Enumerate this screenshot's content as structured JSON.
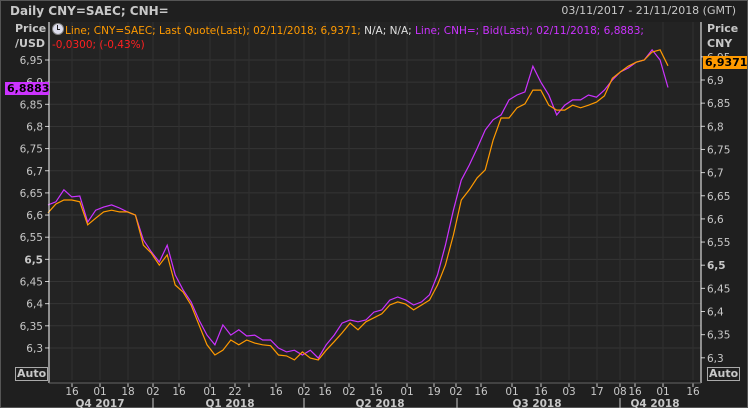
{
  "header": {
    "title": "Daily CNY=SAEC; CNH=",
    "date_range": "03/11/2017 - 21/11/2018 (GMT)"
  },
  "left_axis": {
    "title_line1": "Price",
    "title_line2": "/USD",
    "auto_label": "Auto"
  },
  "right_axis": {
    "title_line1": "Price",
    "title_line2": "CNY",
    "auto_label": "Auto"
  },
  "legend": {
    "icon": "clock-icon",
    "cny_text": "Line; CNY=SAEC; Last Quote(Last); 02/11/2018; 6,9371;",
    "na_text": "N/A; N/A;",
    "cnh_text": "Line; CNH=; Bid(Last); 02/11/2018; 6,8883;",
    "change_text": "-0,0300; (-0,43%)"
  },
  "badges": {
    "cnh_last": "6,8883",
    "cny_last": "6,9371"
  },
  "colors": {
    "cny": "#ff9a00",
    "cnh": "#cc33ff",
    "change": "#ff2020",
    "grid": "#333333"
  },
  "chart_data": {
    "type": "line",
    "title": "Daily CNY=SAEC; CNH=",
    "xlabel": "",
    "ylabel_left": "Price /USD",
    "ylabel_right": "Price CNY",
    "ylim_left": [
      6.25,
      7.0
    ],
    "ylim_right": [
      6.25,
      7.0
    ],
    "y_ticks_left": [
      {
        "v": 6.95,
        "label": "6,95"
      },
      {
        "v": 6.9,
        "label": "6,9"
      },
      {
        "v": 6.85,
        "label": "6,85"
      },
      {
        "v": 6.8,
        "label": "6,8"
      },
      {
        "v": 6.75,
        "label": "6,75"
      },
      {
        "v": 6.7,
        "label": "6,7"
      },
      {
        "v": 6.65,
        "label": "6,65"
      },
      {
        "v": 6.6,
        "label": "6,6"
      },
      {
        "v": 6.55,
        "label": "6,55"
      },
      {
        "v": 6.5,
        "label": "6,5"
      },
      {
        "v": 6.45,
        "label": "6,45"
      },
      {
        "v": 6.4,
        "label": "6,4"
      },
      {
        "v": 6.35,
        "label": "6,35"
      },
      {
        "v": 6.3,
        "label": "6,3"
      }
    ],
    "y_ticks_right": [
      {
        "v": 6.95,
        "label": "6,95"
      },
      {
        "v": 6.9,
        "label": "6,9"
      },
      {
        "v": 6.85,
        "label": "6,85"
      },
      {
        "v": 6.8,
        "label": "6,8"
      },
      {
        "v": 6.75,
        "label": "6,75"
      },
      {
        "v": 6.7,
        "label": "6,7"
      },
      {
        "v": 6.65,
        "label": "6,65"
      },
      {
        "v": 6.6,
        "label": "6,6"
      },
      {
        "v": 6.55,
        "label": "6,55"
      },
      {
        "v": 6.5,
        "label": "6,5"
      },
      {
        "v": 6.45,
        "label": "6,45"
      },
      {
        "v": 6.4,
        "label": "6,4"
      },
      {
        "v": 6.35,
        "label": "6,35"
      },
      {
        "v": 6.3,
        "label": "6,3"
      }
    ],
    "x_tick_labels": [
      "16",
      "01",
      "18",
      "02",
      "16",
      "01",
      "22",
      "",
      "16",
      "02",
      "16",
      "02",
      "16",
      "01",
      "19",
      "02",
      "16",
      "01",
      "16",
      "03",
      "17",
      "08",
      "16",
      "01",
      "16"
    ],
    "quarters": [
      "Q4 2017",
      "Q1 2018",
      "Q2 2018",
      "Q3 2018",
      "Q4 2018"
    ],
    "x_range": [
      "03/11/2017",
      "02/11/2018"
    ],
    "series": [
      {
        "name": "CNY=SAEC Last Quote",
        "values": [
          6.605,
          6.625,
          6.634,
          6.634,
          6.63,
          6.578,
          6.593,
          6.607,
          6.611,
          6.607,
          6.607,
          6.6,
          6.532,
          6.514,
          6.487,
          6.51,
          6.442,
          6.426,
          6.397,
          6.352,
          6.307,
          6.284,
          6.295,
          6.318,
          6.307,
          6.318,
          6.311,
          6.307,
          6.305,
          6.284,
          6.282,
          6.273,
          6.291,
          6.277,
          6.273,
          6.295,
          6.314,
          6.334,
          6.356,
          6.341,
          6.359,
          6.368,
          6.377,
          6.397,
          6.404,
          6.399,
          6.386,
          6.397,
          6.408,
          6.442,
          6.487,
          6.555,
          6.634,
          6.657,
          6.684,
          6.702,
          6.769,
          6.819,
          6.819,
          6.842,
          6.851,
          6.882,
          6.882,
          6.848,
          6.837,
          6.837,
          6.848,
          6.842,
          6.848,
          6.855,
          6.869,
          6.909,
          6.923,
          6.936,
          6.945,
          6.95,
          6.968,
          6.973,
          6.937
        ]
      },
      {
        "name": "CNH= Bid",
        "values": [
          6.623,
          6.63,
          6.657,
          6.641,
          6.643,
          6.584,
          6.611,
          6.618,
          6.623,
          6.616,
          6.607,
          6.6,
          6.544,
          6.517,
          6.494,
          6.532,
          6.465,
          6.431,
          6.404,
          6.363,
          6.329,
          6.307,
          6.352,
          6.329,
          6.341,
          6.327,
          6.329,
          6.318,
          6.318,
          6.3,
          6.291,
          6.295,
          6.284,
          6.295,
          6.277,
          6.307,
          6.329,
          6.356,
          6.363,
          6.359,
          6.363,
          6.381,
          6.386,
          6.408,
          6.415,
          6.408,
          6.397,
          6.404,
          6.42,
          6.465,
          6.532,
          6.611,
          6.679,
          6.713,
          6.751,
          6.792,
          6.815,
          6.826,
          6.86,
          6.871,
          6.878,
          6.936,
          6.9,
          6.871,
          6.826,
          6.848,
          6.86,
          6.86,
          6.871,
          6.866,
          6.882,
          6.905,
          6.923,
          6.932,
          6.945,
          6.95,
          6.973,
          6.95,
          6.888
        ]
      }
    ],
    "grid": true,
    "legend_placement": "top-left"
  }
}
